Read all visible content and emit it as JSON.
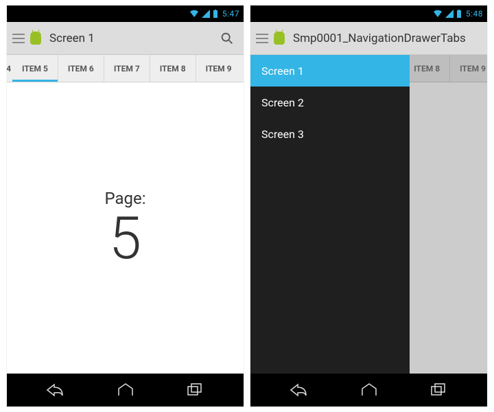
{
  "phone1": {
    "status": {
      "time": "5:47"
    },
    "actionbar": {
      "title": "Screen 1"
    },
    "tabs": {
      "left_partial": "4",
      "items": [
        "ITEM 5",
        "ITEM 6",
        "ITEM 7",
        "ITEM 8"
      ],
      "right_partial": "ITEM 9",
      "selected_index": 0
    },
    "content": {
      "label": "Page:",
      "number": "5"
    }
  },
  "phone2": {
    "status": {
      "time": "5:48"
    },
    "actionbar": {
      "title": "Smp0001_NavigationDrawerTabs"
    },
    "tabs": {
      "right_items": [
        "ITEM 8",
        "ITEM 9"
      ]
    },
    "drawer": {
      "items": [
        "Screen 1",
        "Screen 2",
        "Screen 3"
      ],
      "selected_index": 0
    }
  }
}
